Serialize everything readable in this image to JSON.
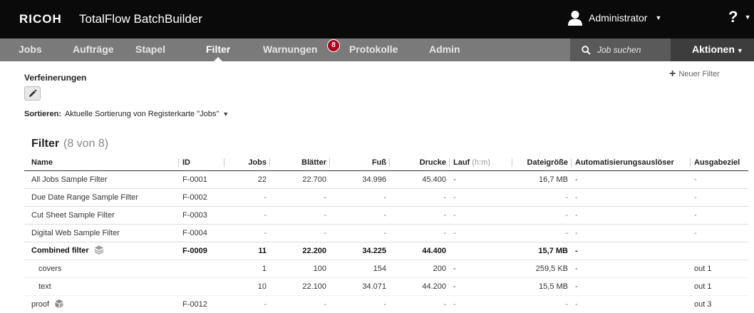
{
  "header": {
    "brand": "RICOH",
    "product": "TotalFlow BatchBuilder",
    "user": "Administrator",
    "help": "?"
  },
  "nav": {
    "tabs": [
      {
        "label": "Jobs"
      },
      {
        "label": "Aufträge"
      },
      {
        "label": "Stapel"
      },
      {
        "label": "Filter",
        "active": true
      },
      {
        "label": "Warnungen",
        "badge": "8"
      },
      {
        "label": "Protokolle"
      },
      {
        "label": "Admin"
      }
    ],
    "search_placeholder": "Job suchen",
    "actions_label": "Aktionen"
  },
  "refinements": {
    "title": "Verfeinerungen",
    "new_filter": "Neuer Filter"
  },
  "sort": {
    "label": "Sortieren:",
    "value": "Aktuelle Sortierung von Registerkarte \"Jobs\""
  },
  "filters": {
    "title": "Filter",
    "count": "(8 von 8)",
    "columns": {
      "name": "Name",
      "id": "ID",
      "jobs": "Jobs",
      "sheets": "Blätter",
      "feet": "Fuß",
      "prints": "Drucke",
      "run": "Lauf",
      "run_unit": "(h:m)",
      "size": "Dateigröße",
      "trigger": "Automatisierungsauslöser",
      "output": "Ausgabeziel"
    },
    "rows": [
      {
        "name": "All Jobs Sample Filter",
        "id": "F-0001",
        "jobs": "22",
        "sheets": "22.700",
        "feet": "34.996",
        "prints": "45.400",
        "run": "-",
        "size": "16,7 MB",
        "trigger": "-",
        "output": "-"
      },
      {
        "name": "Due Date Range Sample Filter",
        "id": "F-0002",
        "jobs": "-",
        "sheets": "-",
        "feet": "-",
        "prints": "-",
        "run": "-",
        "size": "-",
        "trigger": "-",
        "output": "-"
      },
      {
        "name": "Cut Sheet Sample Filter",
        "id": "F-0003",
        "jobs": "-",
        "sheets": "-",
        "feet": "-",
        "prints": "-",
        "run": "-",
        "size": "-",
        "trigger": "-",
        "output": "-"
      },
      {
        "name": "Digital Web Sample Filter",
        "id": "F-0004",
        "jobs": "-",
        "sheets": "-",
        "feet": "-",
        "prints": "-",
        "run": "-",
        "size": "-",
        "trigger": "-",
        "output": "-"
      },
      {
        "name": "Combined filter",
        "id": "F-0009",
        "jobs": "11",
        "sheets": "22.200",
        "feet": "34.225",
        "prints": "44.400",
        "run": "",
        "size": "15,7 MB",
        "trigger": "-",
        "output": ""
      },
      {
        "name": "covers",
        "id": "",
        "jobs": "1",
        "sheets": "100",
        "feet": "154",
        "prints": "200",
        "run": "-",
        "size": "259,5 KB",
        "trigger": "-",
        "output": "out 1"
      },
      {
        "name": "text",
        "id": "",
        "jobs": "10",
        "sheets": "22.100",
        "feet": "34.071",
        "prints": "44.200",
        "run": "-",
        "size": "15,5 MB",
        "trigger": "-",
        "output": "out 1"
      },
      {
        "name": "proof",
        "id": "F-0012",
        "jobs": "-",
        "sheets": "-",
        "feet": "-",
        "prints": "-",
        "run": "-",
        "size": "-",
        "trigger": "-",
        "output": "out 3"
      }
    ]
  }
}
